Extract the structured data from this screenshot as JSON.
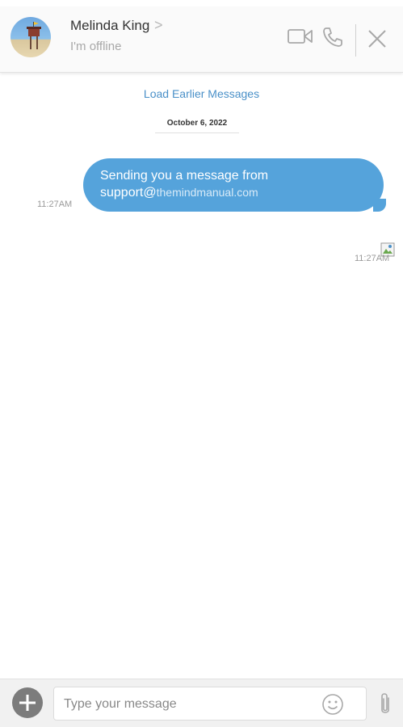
{
  "header": {
    "contact_name": "Melinda King",
    "chevron": ">",
    "status": "I'm offline",
    "icons": [
      "video-icon",
      "phone-icon",
      "close-icon"
    ]
  },
  "conversation": {
    "load_earlier": "Load Earlier Messages",
    "date": "October 6, 2022",
    "messages": [
      {
        "text_main": "Sending you a message from",
        "text_email_user": "support@",
        "text_email_domain": "themindmanual.com",
        "time": "11:27AM"
      },
      {
        "attachment": "broken-image-icon",
        "time": "11:27AM"
      }
    ]
  },
  "composer": {
    "placeholder": "Type your message",
    "icons": [
      "add-icon",
      "emoji-icon",
      "paperclip-icon"
    ]
  },
  "colors": {
    "bubble": "#55a3db",
    "link": "#4a90c8",
    "header_bg": "#fafafa",
    "footer_bg": "#f1f1f1"
  }
}
